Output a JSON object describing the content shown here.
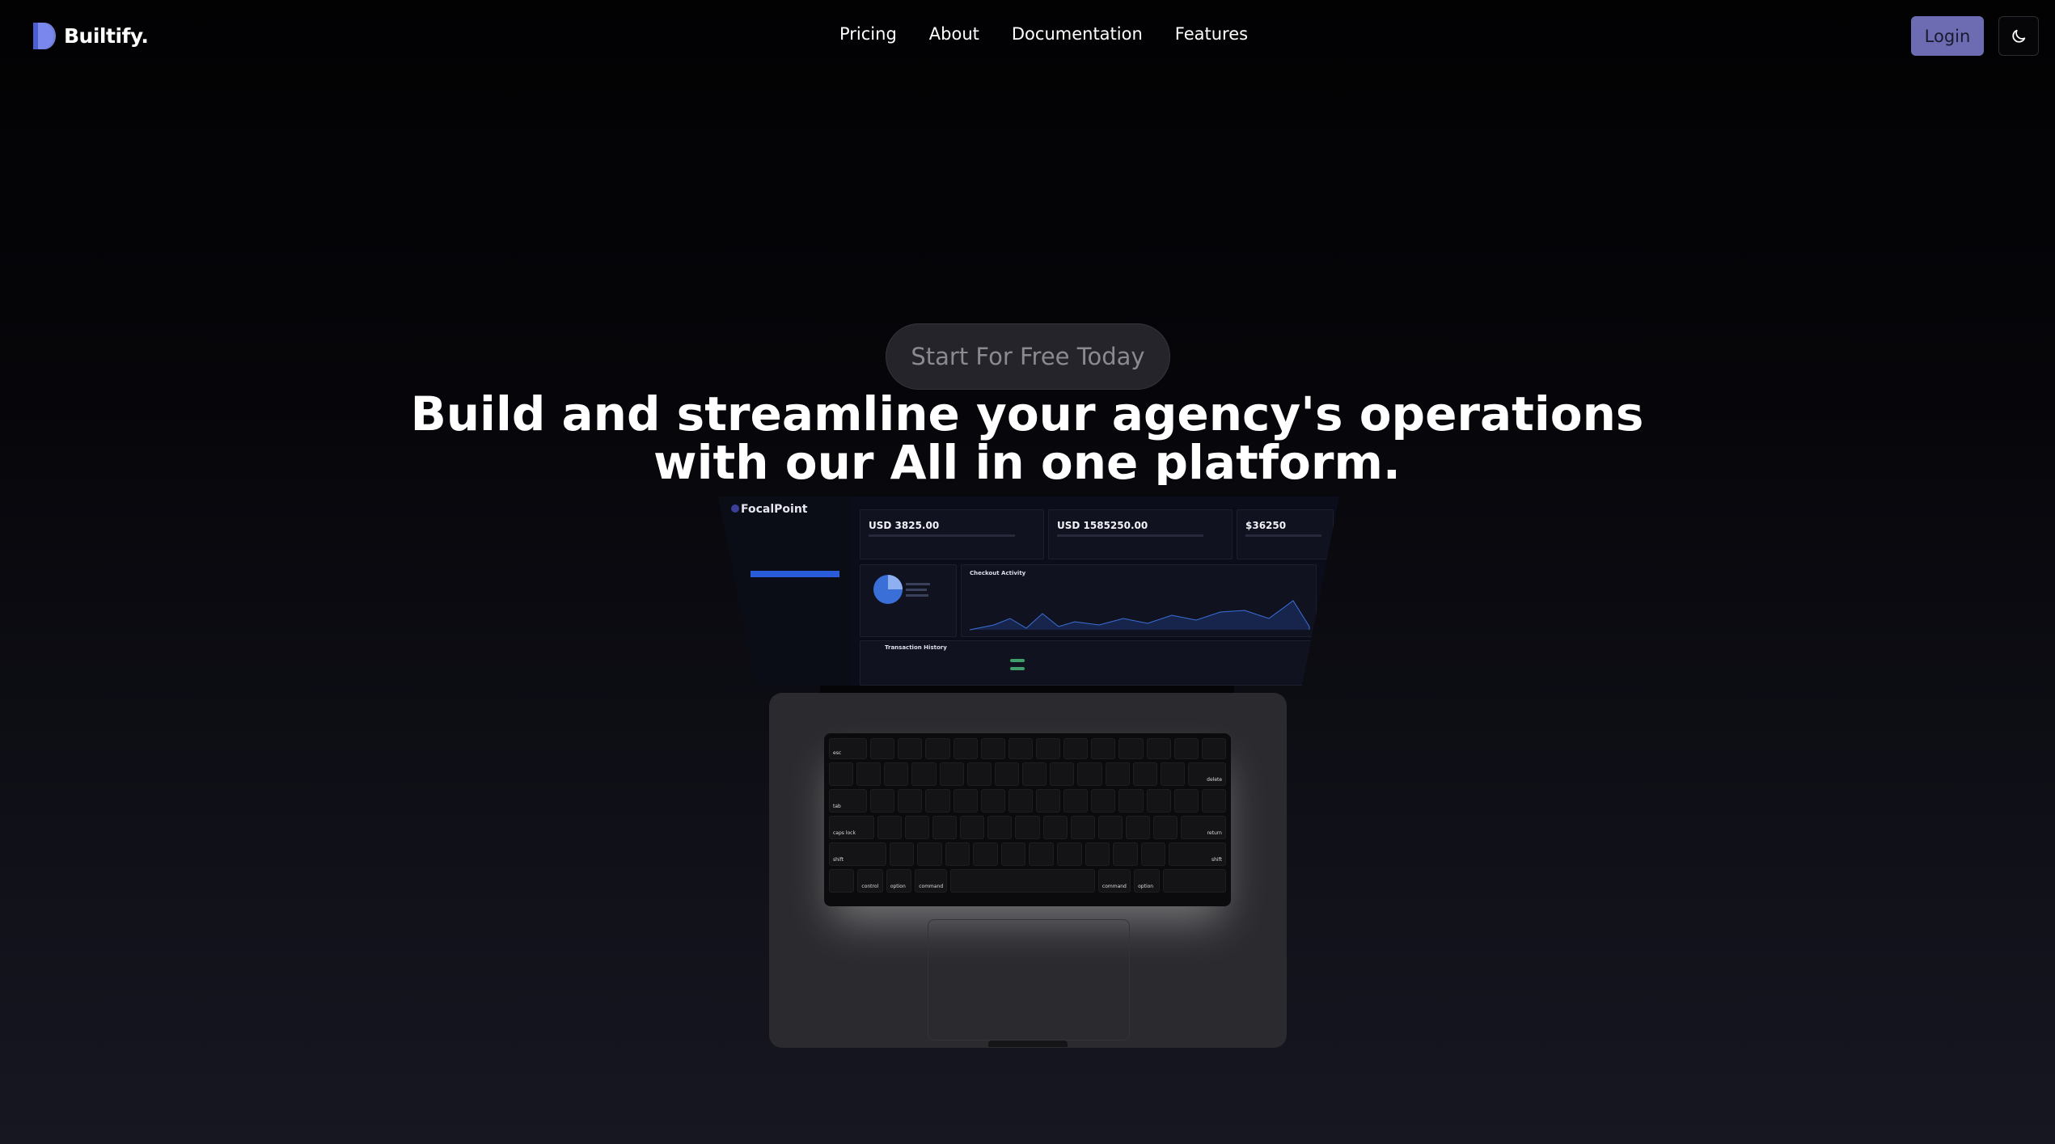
{
  "brand": {
    "name": "Builtify."
  },
  "nav": {
    "links": [
      "Pricing",
      "About",
      "Documentation",
      "Features"
    ],
    "login_label": "Login"
  },
  "hero": {
    "cta_label": "Start For Free Today",
    "headline_line1": "Build and streamline your agency's operations",
    "headline_line2": "with our All in one platform."
  },
  "mockup": {
    "app_name": "FocalPoint",
    "cards": [
      "USD 3825.00",
      "USD 1585250.00",
      "$36250"
    ],
    "chart_title": "Checkout Activity",
    "table_title": "Transaction History"
  },
  "keyboard": {
    "esc": "esc",
    "delete": "delete",
    "tab": "tab",
    "caps": "caps lock",
    "return": "return",
    "shift": "shift",
    "control": "control",
    "option": "option",
    "command": "command"
  },
  "colors": {
    "accent": "#6d6cb3",
    "background": "#020203"
  }
}
